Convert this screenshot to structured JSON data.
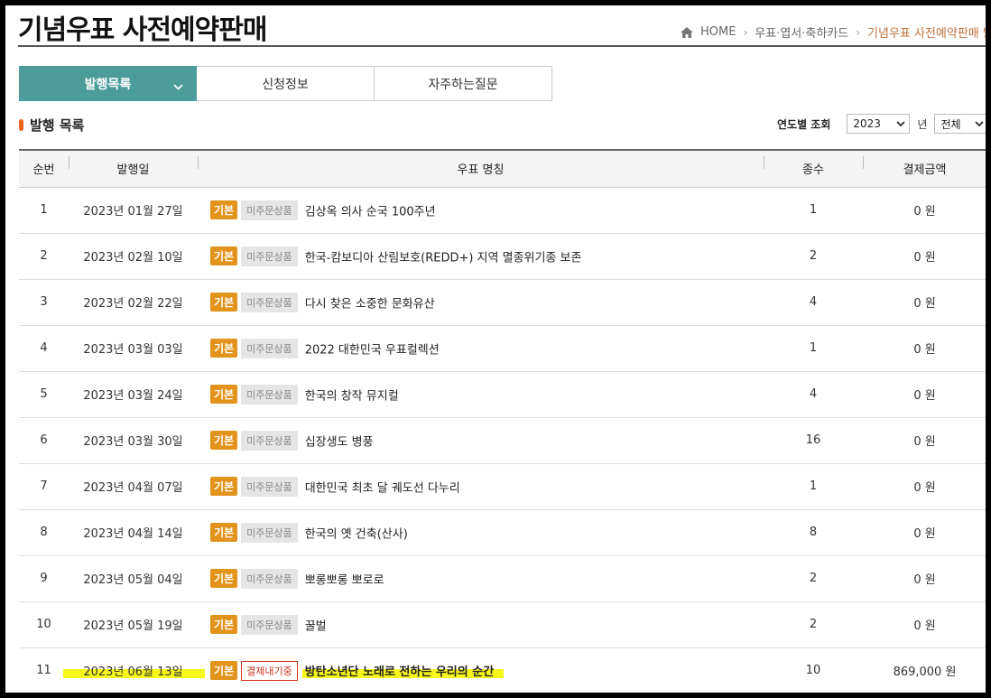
{
  "header": {
    "title": "기념우표 사전예약판매",
    "breadcrumb": {
      "home": "HOME",
      "level1": "우표·엽서·축하카드",
      "current": "기념우표 사전예약판매 발행"
    }
  },
  "tabs": [
    {
      "label": "발행목록",
      "active": true
    },
    {
      "label": "신청정보",
      "active": false
    },
    {
      "label": "자주하는질문",
      "active": false
    }
  ],
  "section": {
    "title": "발행 목록",
    "filter_label": "연도별 조회",
    "year_value": "2023",
    "year_unit": "년",
    "type_value": "전체"
  },
  "table": {
    "columns": [
      "순번",
      "발행일",
      "우표 명칭",
      "종수",
      "결제금액"
    ],
    "rows": [
      {
        "no": "1",
        "date": "2023년 01월 27일",
        "basic": "기본",
        "status": "미주문상품",
        "name": "김상옥 의사 순국 100주년",
        "count": "1",
        "amount": "0 원"
      },
      {
        "no": "2",
        "date": "2023년 02월 10일",
        "basic": "기본",
        "status": "미주문상품",
        "name": "한국-캄보디아 산림보호(REDD+) 지역 멸종위기종 보존",
        "count": "2",
        "amount": "0 원"
      },
      {
        "no": "3",
        "date": "2023년 02월 22일",
        "basic": "기본",
        "status": "미주문상품",
        "name": "다시 찾은 소중한 문화유산",
        "count": "4",
        "amount": "0 원"
      },
      {
        "no": "4",
        "date": "2023년 03월 03일",
        "basic": "기본",
        "status": "미주문상품",
        "name": "2022 대한민국 우표컬렉션",
        "count": "1",
        "amount": "0 원"
      },
      {
        "no": "5",
        "date": "2023년 03월 24일",
        "basic": "기본",
        "status": "미주문상품",
        "name": "한국의 창작 뮤지컬",
        "count": "4",
        "amount": "0 원"
      },
      {
        "no": "6",
        "date": "2023년 03월 30일",
        "basic": "기본",
        "status": "미주문상품",
        "name": "십장생도 병풍",
        "count": "16",
        "amount": "0 원"
      },
      {
        "no": "7",
        "date": "2023년 04월 07일",
        "basic": "기본",
        "status": "미주문상품",
        "name": "대한민국 최초 달 궤도선 다누리",
        "count": "1",
        "amount": "0 원"
      },
      {
        "no": "8",
        "date": "2023년 04월 14일",
        "basic": "기본",
        "status": "미주문상품",
        "name": "한국의 옛 건축(산사)",
        "count": "8",
        "amount": "0 원"
      },
      {
        "no": "9",
        "date": "2023년 05월 04일",
        "basic": "기본",
        "status": "미주문상품",
        "name": "뽀롱뽀롱 뽀로로",
        "count": "2",
        "amount": "0 원"
      },
      {
        "no": "10",
        "date": "2023년 05월 19일",
        "basic": "기본",
        "status": "미주문상품",
        "name": "꿀벌",
        "count": "2",
        "amount": "0 원"
      },
      {
        "no": "11",
        "date": "2023년 06월 13일",
        "basic": "기본",
        "status": "결제내기중",
        "name": "방탄소년단 노래로 전하는 우리의 순간",
        "count": "10",
        "amount": "869,000 원"
      }
    ]
  },
  "colors": {
    "accent": "#4b9c9a",
    "badge_basic": "#e2931b",
    "highlight": "#f7f71c",
    "pay_status": "#d0311c",
    "section_marker": "#e8631c"
  }
}
